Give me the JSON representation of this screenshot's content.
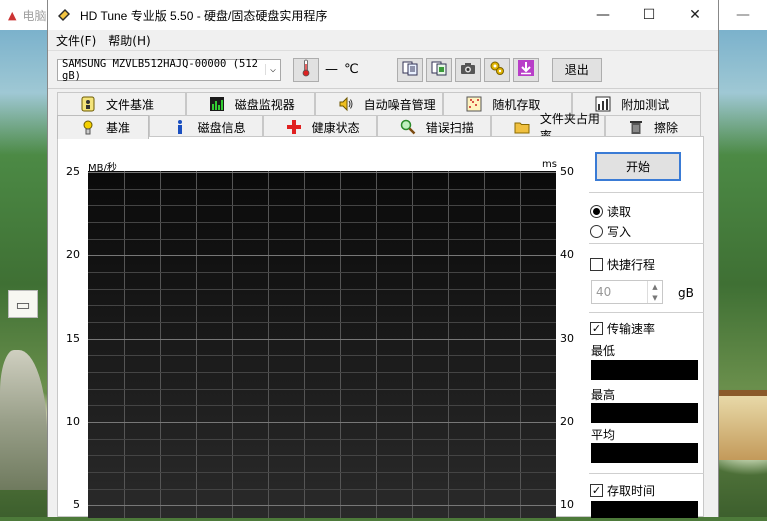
{
  "desktop": {
    "left_title": "电脑",
    "colors": {
      "window_bg": "#f0f0f0",
      "plot_bg": "#000000",
      "accent": "#3a7bd5"
    }
  },
  "window": {
    "title": "HD Tune 专业版 5.50 - 硬盘/固态硬盘实用程序",
    "controls": {
      "minimize": "—",
      "maximize": "☐",
      "close": "✕"
    }
  },
  "menu": [
    {
      "label": "文件(F)"
    },
    {
      "label": "帮助(H)"
    }
  ],
  "toolbar": {
    "drive": "SAMSUNG MZVLB512HAJQ-00000 (512 gB)",
    "temperature": "— ℃",
    "exit_label": "退出",
    "icons": [
      "thermometer-icon",
      "copy-info-icon",
      "copy-screenshot-icon",
      "camera-icon",
      "settings-icon",
      "save-icon"
    ]
  },
  "tabs_back": [
    {
      "label": "文件基准",
      "icon": "info-person-icon"
    },
    {
      "label": "磁盘监视器",
      "icon": "bar-chart-icon"
    },
    {
      "label": "自动噪音管理",
      "icon": "speaker-icon"
    },
    {
      "label": "随机存取",
      "icon": "random-dots-icon"
    },
    {
      "label": "附加测试",
      "icon": "extra-chart-icon"
    }
  ],
  "tabs_front": [
    {
      "label": "基准",
      "icon": "benchmark-icon",
      "active": true
    },
    {
      "label": "磁盘信息",
      "icon": "info-icon"
    },
    {
      "label": "健康状态",
      "icon": "health-cross-icon"
    },
    {
      "label": "错误扫描",
      "icon": "magnifier-icon"
    },
    {
      "label": "文件夹占用率",
      "icon": "folder-icon"
    },
    {
      "label": "擦除",
      "icon": "trash-icon"
    }
  ],
  "chart_data": {
    "type": "line",
    "xlabel": "",
    "ylabel": "MB/秒",
    "y2label": "ms",
    "y_ticks": [
      "25",
      "20",
      "15",
      "10",
      "5"
    ],
    "y2_ticks": [
      "50",
      "40",
      "30",
      "20",
      "10"
    ],
    "ylim": [
      0,
      25
    ],
    "y2lim": [
      0,
      50
    ],
    "grid": true,
    "series": []
  },
  "panel": {
    "start_label": "开始",
    "read_label": "读取",
    "write_label": "写入",
    "mode": "read",
    "short_stroke_label": "快捷行程",
    "short_stroke_checked": false,
    "short_stroke_value": "40",
    "short_stroke_unit": "gB",
    "transfer_rate_label": "传输速率",
    "transfer_rate_checked": true,
    "min_label": "最低",
    "max_label": "最高",
    "avg_label": "平均",
    "access_time_label": "存取时间",
    "access_time_checked": true
  }
}
